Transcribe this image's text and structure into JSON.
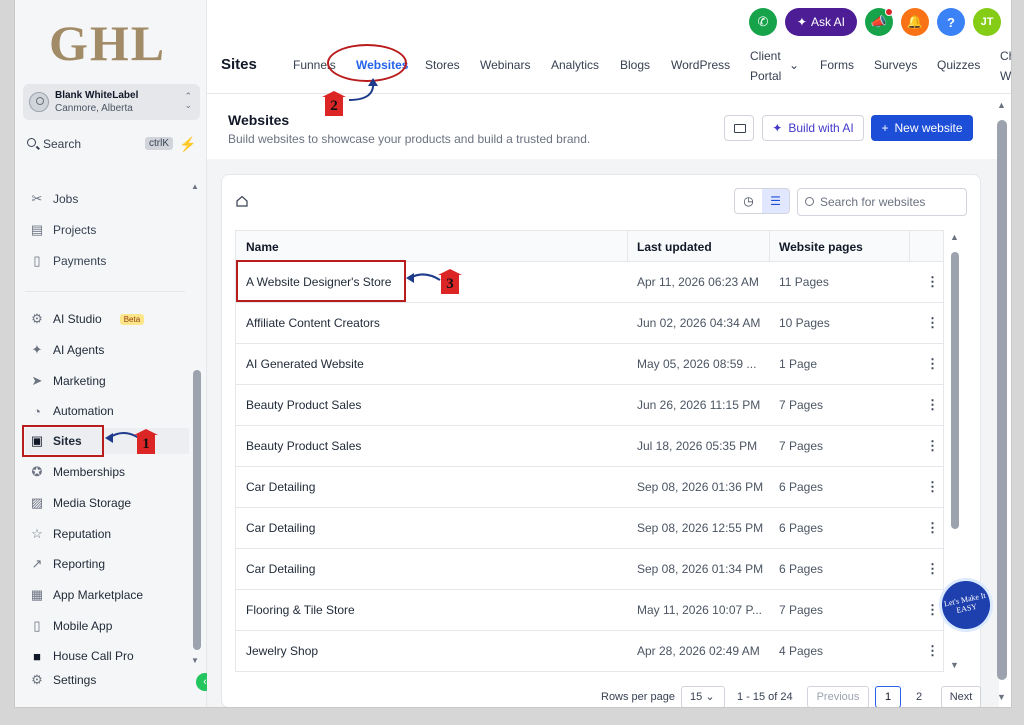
{
  "brand": {
    "logo_text": "GHL"
  },
  "account": {
    "name": "Blank WhiteLabel",
    "location": "Canmore, Alberta"
  },
  "sidebar_search": {
    "label": "Search",
    "shortcut": "ctrlK"
  },
  "sidebar": {
    "items": [
      {
        "label": "Jobs",
        "icon": "briefcase-icon"
      },
      {
        "label": "Projects",
        "icon": "clipboard-icon"
      },
      {
        "label": "Payments",
        "icon": "receipt-icon"
      },
      {
        "label": "AI Studio",
        "icon": "ai-studio-icon",
        "badge": "Beta"
      },
      {
        "label": "AI Agents",
        "icon": "sparkle-icon"
      },
      {
        "label": "Marketing",
        "icon": "send-icon"
      },
      {
        "label": "Automation",
        "icon": "automation-icon"
      },
      {
        "label": "Sites",
        "icon": "sites-icon",
        "active": true
      },
      {
        "label": "Memberships",
        "icon": "award-icon"
      },
      {
        "label": "Media Storage",
        "icon": "image-icon"
      },
      {
        "label": "Reputation",
        "icon": "star-icon"
      },
      {
        "label": "Reporting",
        "icon": "trend-icon"
      },
      {
        "label": "App Marketplace",
        "icon": "grid-icon"
      },
      {
        "label": "Mobile App",
        "icon": "phone-icon"
      },
      {
        "label": "House Call Pro",
        "icon": "toolbox-icon"
      },
      {
        "label": "Settings",
        "icon": "gear-icon"
      }
    ]
  },
  "topbar": {
    "ask_ai": "Ask AI",
    "help": "?",
    "avatar_initials": "JT"
  },
  "nav": {
    "section_title": "Sites",
    "tabs": [
      "Funnels",
      "Websites",
      "Stores",
      "Webinars",
      "Analytics",
      "Blogs",
      "WordPress",
      "Client",
      "Portal",
      "Forms",
      "Surveys",
      "Quizzes",
      "Chat",
      "Widg"
    ],
    "active_tab": "Websites"
  },
  "page": {
    "title": "Websites",
    "subtitle": "Build websites to showcase your products and build a trusted brand.",
    "build_ai_label": "Build with AI",
    "new_website_label": "New website"
  },
  "list": {
    "search_placeholder": "Search for websites",
    "columns": [
      "Name",
      "Last updated",
      "Website pages"
    ],
    "rows": [
      {
        "name": "A Website Designer's Store",
        "updated": "Apr 11, 2026 06:23 AM",
        "pages": "11 Pages"
      },
      {
        "name": "Affiliate Content Creators",
        "updated": "Jun 02, 2026 04:34 AM",
        "pages": "10 Pages"
      },
      {
        "name": "AI Generated Website",
        "updated": "May 05, 2026 08:59 ...",
        "pages": "1 Page"
      },
      {
        "name": "Beauty Product Sales",
        "updated": "Jun 26, 2026 11:15 PM",
        "pages": "7 Pages"
      },
      {
        "name": "Beauty Product Sales",
        "updated": "Jul 18, 2026 05:35 PM",
        "pages": "7 Pages"
      },
      {
        "name": "Car Detailing",
        "updated": "Sep 08, 2026 01:36 PM",
        "pages": "6 Pages"
      },
      {
        "name": "Car Detailing",
        "updated": "Sep 08, 2026 12:55 PM",
        "pages": "6 Pages"
      },
      {
        "name": "Car Detailing",
        "updated": "Sep 08, 2026 01:34 PM",
        "pages": "6 Pages"
      },
      {
        "name": "Flooring & Tile Store",
        "updated": "May 11, 2026 10:07 P...",
        "pages": "7 Pages"
      },
      {
        "name": "Jewelry Shop",
        "updated": "Apr 28, 2026 02:49 AM",
        "pages": "4 Pages"
      }
    ]
  },
  "pagination": {
    "rows_label": "Rows per page",
    "rows_value": "15",
    "range": "1 - 15 of 24",
    "previous": "Previous",
    "page1": "1",
    "page2": "2",
    "next": "Next"
  },
  "annotations": {
    "n1": "1",
    "n2": "2",
    "n3": "3",
    "badge_text": "Let's Make It EASY"
  },
  "colors": {
    "accent": "#2563eb",
    "annotation": "#b91c1c",
    "primary_button": "#1d4ed8",
    "ask_ai": "#4c1d95"
  }
}
